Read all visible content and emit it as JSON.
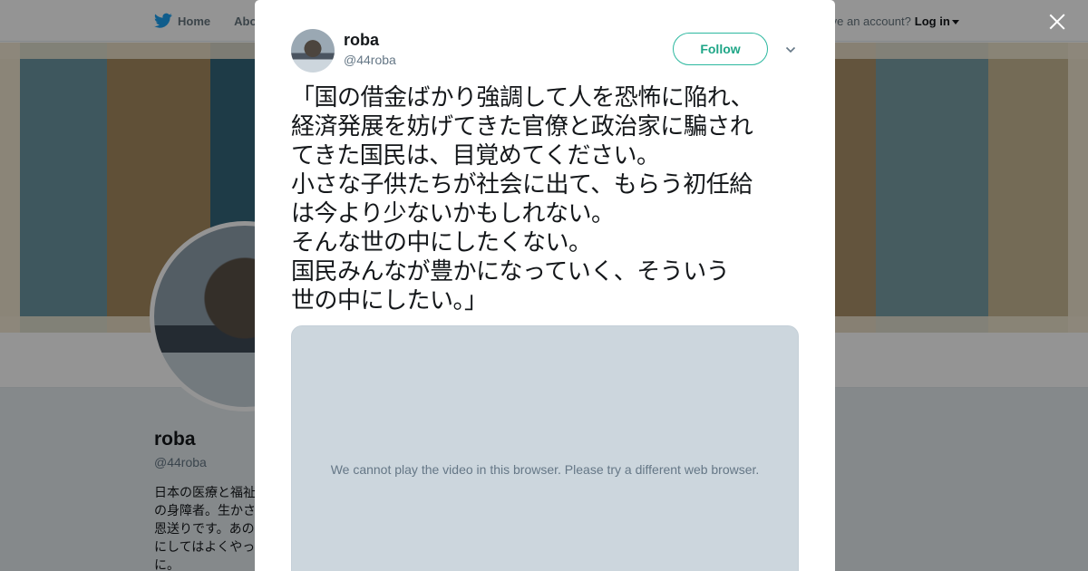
{
  "topbar": {
    "home_label": "Home",
    "about_label": "About",
    "account_prompt": "Have an account?",
    "login_label": "Log in"
  },
  "profile": {
    "name": "roba",
    "handle": "@44roba",
    "bio": "日本の医療と福祉\nの身障者。生かさ\n恩送りです。あの\nにしてはよくやっ\nに。"
  },
  "tweet": {
    "author_name": "roba",
    "author_handle": "@44roba",
    "follow_label": "Follow",
    "text": "「国の借金ばかり強調して人を恐怖に陥れ、\n経済発展を妨げてきた官僚と政治家に騙され\nてきた国民は、目覚めてください。\n小さな子供たちが社会に出て、もらう初任給\nは今より少ないかもしれない。\nそんな世の中にしたくない。\n国民みんなが豊かになっていく、そういう\n世の中にしたい。」",
    "video_message": "We cannot play the video in this browser. Please try a different web browser."
  },
  "icons": {
    "logo": "twitter-bird-icon",
    "close": "close-icon",
    "menu": "chevron-down-icon"
  },
  "colors": {
    "brand": "#1da1f2",
    "follow_accent": "#1fa687"
  }
}
